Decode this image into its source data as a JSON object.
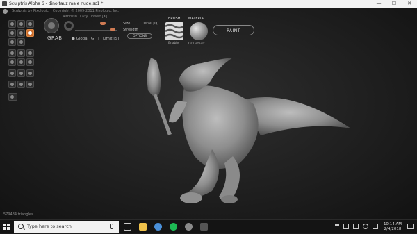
{
  "window": {
    "title": "Sculptris Alpha 6 - dino tauz male nude.sc1 *",
    "buttons": {
      "minimize": "—",
      "maximize": "☐",
      "close": "✕"
    }
  },
  "header": {
    "product": "Sculptris by Pixologic",
    "copyright": "Copyright © 2009-2011 Pixologic, Inc."
  },
  "tool": {
    "name": "GRAB",
    "airbrush": "Airbrush",
    "lazy": "Lazy",
    "invert": "Invert [X]",
    "size_label": "Size",
    "strength_label": "Strength",
    "detail_label": "Detail [Q]",
    "options_label": "OPTIONS",
    "global_label": "Global [G]",
    "limit_label": "Limit [S]"
  },
  "brush": {
    "label": "BRUSH",
    "enable_label": "Enable"
  },
  "material": {
    "label": "MATERIAL",
    "name": "ODDefault"
  },
  "paint_button": "PAINT",
  "status": {
    "triangles": "579434 triangles"
  },
  "taskbar": {
    "search_placeholder": "Type here to search",
    "time": "10:14 AM",
    "date": "2/4/2018"
  },
  "colors": {
    "accent": "#c96a2a",
    "slider_knob": "#d07b53",
    "model": "#9b9b9b"
  },
  "icons": {
    "start": "windows-start-icon",
    "search": "search-icon",
    "mic": "microphone-icon",
    "tray_notifications": "notification-icon"
  }
}
